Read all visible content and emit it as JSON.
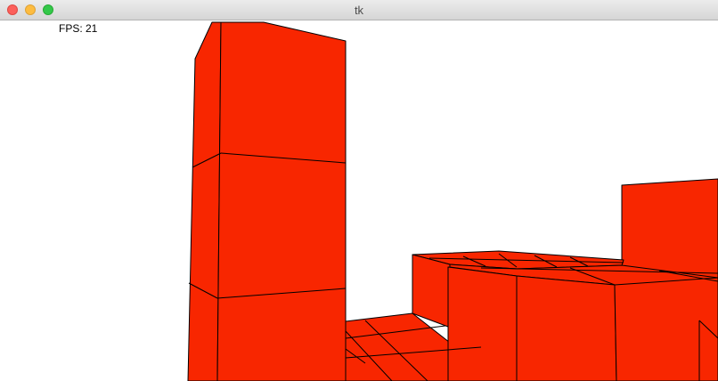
{
  "window": {
    "title": "tk"
  },
  "hud": {
    "fps": "FPS: 21"
  },
  "scene": {
    "face_color": "#f82600",
    "edge_color": "#000000",
    "background": "#ffffff"
  }
}
